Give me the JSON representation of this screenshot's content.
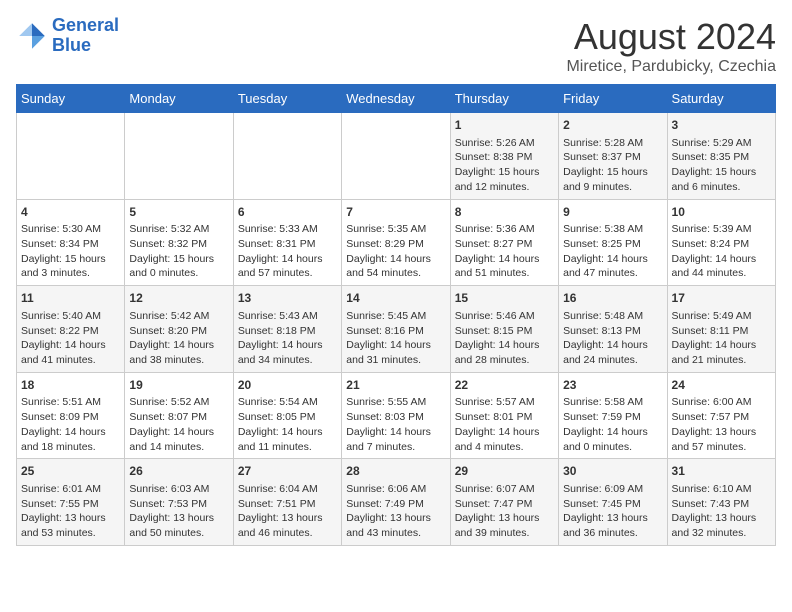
{
  "header": {
    "logo_line1": "General",
    "logo_line2": "Blue",
    "main_title": "August 2024",
    "subtitle": "Miretice, Pardubicky, Czechia"
  },
  "days_of_week": [
    "Sunday",
    "Monday",
    "Tuesday",
    "Wednesday",
    "Thursday",
    "Friday",
    "Saturday"
  ],
  "weeks": [
    [
      {
        "day": "",
        "text": ""
      },
      {
        "day": "",
        "text": ""
      },
      {
        "day": "",
        "text": ""
      },
      {
        "day": "",
        "text": ""
      },
      {
        "day": "1",
        "text": "Sunrise: 5:26 AM\nSunset: 8:38 PM\nDaylight: 15 hours and 12 minutes."
      },
      {
        "day": "2",
        "text": "Sunrise: 5:28 AM\nSunset: 8:37 PM\nDaylight: 15 hours and 9 minutes."
      },
      {
        "day": "3",
        "text": "Sunrise: 5:29 AM\nSunset: 8:35 PM\nDaylight: 15 hours and 6 minutes."
      }
    ],
    [
      {
        "day": "4",
        "text": "Sunrise: 5:30 AM\nSunset: 8:34 PM\nDaylight: 15 hours and 3 minutes."
      },
      {
        "day": "5",
        "text": "Sunrise: 5:32 AM\nSunset: 8:32 PM\nDaylight: 15 hours and 0 minutes."
      },
      {
        "day": "6",
        "text": "Sunrise: 5:33 AM\nSunset: 8:31 PM\nDaylight: 14 hours and 57 minutes."
      },
      {
        "day": "7",
        "text": "Sunrise: 5:35 AM\nSunset: 8:29 PM\nDaylight: 14 hours and 54 minutes."
      },
      {
        "day": "8",
        "text": "Sunrise: 5:36 AM\nSunset: 8:27 PM\nDaylight: 14 hours and 51 minutes."
      },
      {
        "day": "9",
        "text": "Sunrise: 5:38 AM\nSunset: 8:25 PM\nDaylight: 14 hours and 47 minutes."
      },
      {
        "day": "10",
        "text": "Sunrise: 5:39 AM\nSunset: 8:24 PM\nDaylight: 14 hours and 44 minutes."
      }
    ],
    [
      {
        "day": "11",
        "text": "Sunrise: 5:40 AM\nSunset: 8:22 PM\nDaylight: 14 hours and 41 minutes."
      },
      {
        "day": "12",
        "text": "Sunrise: 5:42 AM\nSunset: 8:20 PM\nDaylight: 14 hours and 38 minutes."
      },
      {
        "day": "13",
        "text": "Sunrise: 5:43 AM\nSunset: 8:18 PM\nDaylight: 14 hours and 34 minutes."
      },
      {
        "day": "14",
        "text": "Sunrise: 5:45 AM\nSunset: 8:16 PM\nDaylight: 14 hours and 31 minutes."
      },
      {
        "day": "15",
        "text": "Sunrise: 5:46 AM\nSunset: 8:15 PM\nDaylight: 14 hours and 28 minutes."
      },
      {
        "day": "16",
        "text": "Sunrise: 5:48 AM\nSunset: 8:13 PM\nDaylight: 14 hours and 24 minutes."
      },
      {
        "day": "17",
        "text": "Sunrise: 5:49 AM\nSunset: 8:11 PM\nDaylight: 14 hours and 21 minutes."
      }
    ],
    [
      {
        "day": "18",
        "text": "Sunrise: 5:51 AM\nSunset: 8:09 PM\nDaylight: 14 hours and 18 minutes."
      },
      {
        "day": "19",
        "text": "Sunrise: 5:52 AM\nSunset: 8:07 PM\nDaylight: 14 hours and 14 minutes."
      },
      {
        "day": "20",
        "text": "Sunrise: 5:54 AM\nSunset: 8:05 PM\nDaylight: 14 hours and 11 minutes."
      },
      {
        "day": "21",
        "text": "Sunrise: 5:55 AM\nSunset: 8:03 PM\nDaylight: 14 hours and 7 minutes."
      },
      {
        "day": "22",
        "text": "Sunrise: 5:57 AM\nSunset: 8:01 PM\nDaylight: 14 hours and 4 minutes."
      },
      {
        "day": "23",
        "text": "Sunrise: 5:58 AM\nSunset: 7:59 PM\nDaylight: 14 hours and 0 minutes."
      },
      {
        "day": "24",
        "text": "Sunrise: 6:00 AM\nSunset: 7:57 PM\nDaylight: 13 hours and 57 minutes."
      }
    ],
    [
      {
        "day": "25",
        "text": "Sunrise: 6:01 AM\nSunset: 7:55 PM\nDaylight: 13 hours and 53 minutes."
      },
      {
        "day": "26",
        "text": "Sunrise: 6:03 AM\nSunset: 7:53 PM\nDaylight: 13 hours and 50 minutes."
      },
      {
        "day": "27",
        "text": "Sunrise: 6:04 AM\nSunset: 7:51 PM\nDaylight: 13 hours and 46 minutes."
      },
      {
        "day": "28",
        "text": "Sunrise: 6:06 AM\nSunset: 7:49 PM\nDaylight: 13 hours and 43 minutes."
      },
      {
        "day": "29",
        "text": "Sunrise: 6:07 AM\nSunset: 7:47 PM\nDaylight: 13 hours and 39 minutes."
      },
      {
        "day": "30",
        "text": "Sunrise: 6:09 AM\nSunset: 7:45 PM\nDaylight: 13 hours and 36 minutes."
      },
      {
        "day": "31",
        "text": "Sunrise: 6:10 AM\nSunset: 7:43 PM\nDaylight: 13 hours and 32 minutes."
      }
    ]
  ]
}
